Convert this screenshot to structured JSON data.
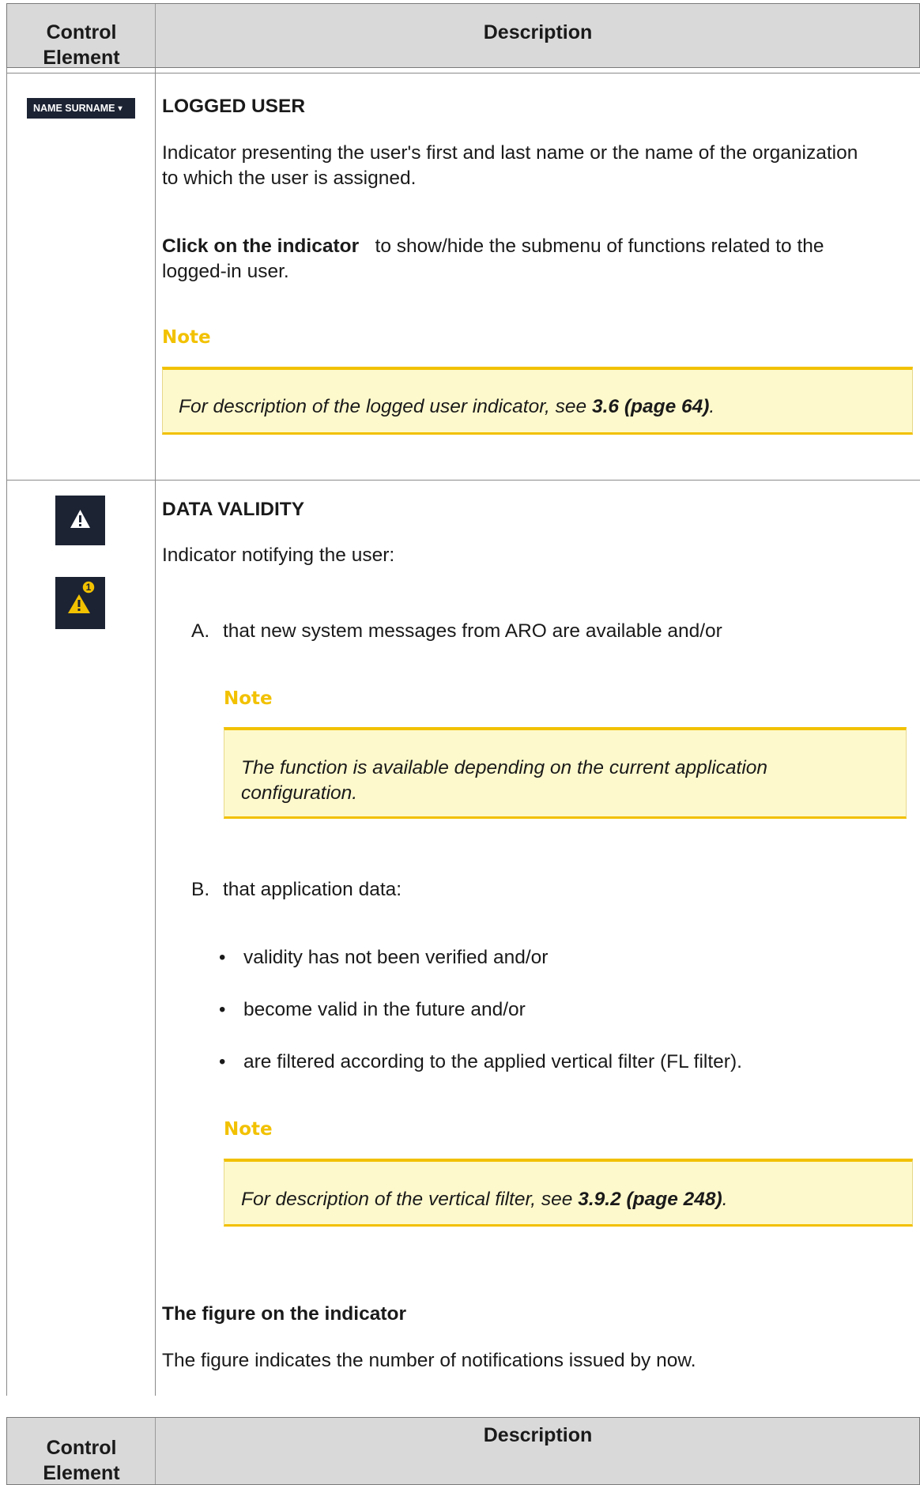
{
  "table_header": {
    "control_line1": "Control",
    "control_line2": "Element",
    "description": "Description"
  },
  "logged_user": {
    "badge_label": "NAME SURNAME",
    "title": "LOGGED USER",
    "desc_line1": "Indicator presenting the user's first and last name or the name of the organization",
    "desc_line2": "to which the user is assigned.",
    "click_bold": "Click on the indicator",
    "click_rest": "to show/hide the submenu of functions related to the",
    "click_line2": "logged-in user.",
    "note_label": "Note",
    "note_prefix": "For description of the logged user indicator, see ",
    "note_ref": "3.6 (page 64)",
    "note_suffix": "."
  },
  "data_validity": {
    "title": "DATA VALIDITY",
    "intro": "Indicator notifying the user:",
    "badge_count": "1",
    "item_a_marker": "A.",
    "item_a_text": "that new system messages from ARO are available and/or",
    "note1_label": "Note",
    "note1_line1": "The function is available depending on the current application",
    "note1_line2": "configuration.",
    "item_b_marker": "B.",
    "item_b_text": "that application data:",
    "bullets": [
      "validity has not been verified and/or",
      "become valid in the future and/or",
      "are filtered according to the applied vertical filter (FL filter)."
    ],
    "note2_label": "Note",
    "note2_prefix": "For description of the vertical filter, see ",
    "note2_ref": "3.9.2 (page 248)",
    "note2_suffix": ".",
    "figure_title": "The figure on the indicator",
    "figure_desc": "The figure indicates the number of notifications issued by now."
  },
  "icons": {
    "warning": "warning-icon",
    "warning_badge": "warning-with-count-icon",
    "caret": "caret-down-icon"
  },
  "colors": {
    "header_bg": "#d9d9d9",
    "note_accent": "#f2c100",
    "note_bg": "#fef9cc",
    "icon_bg": "#1c2333"
  }
}
